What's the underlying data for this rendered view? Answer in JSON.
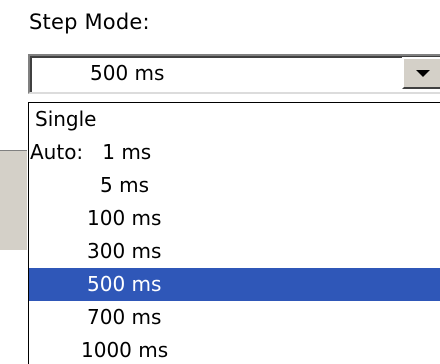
{
  "step_mode": {
    "label": "Step Mode:",
    "selected_value": "500 ms"
  },
  "dropdown": {
    "options": [
      {
        "label": "Single"
      },
      {
        "label": "Auto:   1 ms"
      },
      {
        "label": "5 ms"
      },
      {
        "label": "100 ms"
      },
      {
        "label": "300 ms"
      },
      {
        "label": "500 ms",
        "selected": true
      },
      {
        "label": "700 ms"
      },
      {
        "label": "1000 ms"
      }
    ]
  },
  "colors": {
    "selection": "#2f57b8",
    "button_face": "#d4d0c8"
  },
  "icons": {
    "dropdown_arrow": "chevron-down-icon"
  }
}
